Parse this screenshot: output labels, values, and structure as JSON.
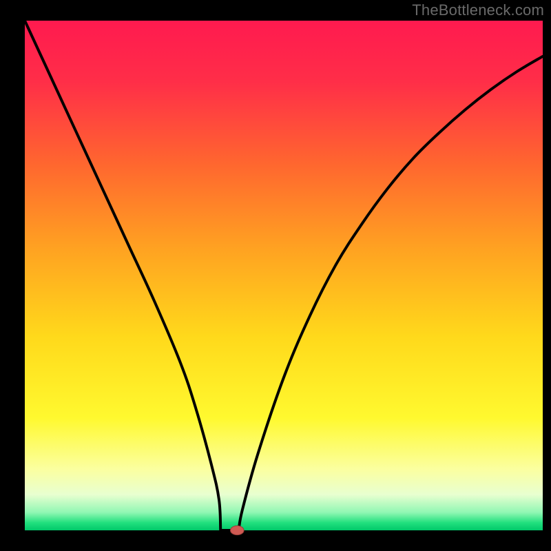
{
  "watermark": "TheBottleneck.com",
  "plot": {
    "margin_left": 36,
    "margin_right": 12,
    "margin_top": 30,
    "margin_bottom": 30
  },
  "colors": {
    "frame": "#000000",
    "curve": "#000000",
    "marker_fill": "#cf5a53",
    "marker_stroke": "#9a3e39",
    "gradient_stops": [
      {
        "offset": 0.0,
        "color": "#ff1a4f"
      },
      {
        "offset": 0.12,
        "color": "#ff2e48"
      },
      {
        "offset": 0.28,
        "color": "#ff662f"
      },
      {
        "offset": 0.45,
        "color": "#ffa321"
      },
      {
        "offset": 0.62,
        "color": "#ffd91b"
      },
      {
        "offset": 0.78,
        "color": "#fff92f"
      },
      {
        "offset": 0.88,
        "color": "#fbffa0"
      },
      {
        "offset": 0.93,
        "color": "#e8ffd0"
      },
      {
        "offset": 0.965,
        "color": "#90f7b3"
      },
      {
        "offset": 0.985,
        "color": "#22e07e"
      },
      {
        "offset": 1.0,
        "color": "#00c96a"
      }
    ]
  },
  "chart_data": {
    "type": "line",
    "title": "",
    "xlabel": "",
    "ylabel": "",
    "xlim": [
      0,
      100
    ],
    "ylim": [
      0,
      100
    ],
    "series": [
      {
        "name": "bottleneck-curve",
        "x": [
          0,
          5,
          10,
          15,
          20,
          25,
          30,
          33,
          36,
          37.5,
          39.5,
          40.5,
          42,
          45,
          50,
          55,
          60,
          65,
          70,
          75,
          80,
          85,
          90,
          95,
          100
        ],
        "values": [
          100,
          89,
          78,
          67,
          56,
          45,
          33,
          24,
          13,
          6,
          0,
          0,
          4,
          15,
          30,
          42,
          52,
          60,
          67,
          73,
          78,
          82.5,
          86.5,
          90,
          93
        ]
      }
    ],
    "flat_segment": {
      "x0": 37.8,
      "x1": 41.3,
      "y": 0
    },
    "marker": {
      "x": 41,
      "y": 0,
      "rx": 1.3,
      "ry": 0.9
    }
  }
}
